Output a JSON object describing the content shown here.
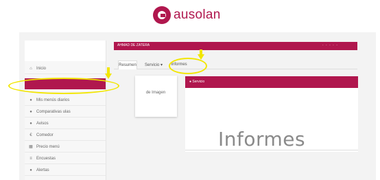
{
  "logo": {
    "text": "ausolan"
  },
  "header": {
    "title": "AHMAD DE ZATERA",
    "right": "· · · · ·"
  },
  "sidebar": {
    "items": [
      {
        "icon": "home-icon",
        "glyph": "⌂",
        "label": "Inicio"
      },
      {
        "icon": "",
        "glyph": "",
        "label": ""
      },
      {
        "icon": "circle-icon",
        "glyph": "●",
        "label": "Mis menús diarios"
      },
      {
        "icon": "circle-icon",
        "glyph": "●",
        "label": "Comparativas ulas"
      },
      {
        "icon": "circle-icon",
        "glyph": "●",
        "label": "Avisos"
      },
      {
        "icon": "euro-icon",
        "glyph": "€",
        "label": "Comedor"
      },
      {
        "icon": "document-icon",
        "glyph": "▦",
        "label": "Precio menú"
      },
      {
        "icon": "list-icon",
        "glyph": "≡",
        "label": "Encuestas"
      },
      {
        "icon": "circle-icon",
        "glyph": "●",
        "label": "Alertas"
      }
    ]
  },
  "tabs": [
    {
      "label": "Resumen"
    },
    {
      "label": "Servicio ▾"
    },
    {
      "label": "Informes"
    }
  ],
  "card": {
    "label": "de Imagen"
  },
  "panel": {
    "title": "● Servicio",
    "big_text": "Informes"
  },
  "colors": {
    "brand": "#b0174e",
    "annotation": "#f2e600"
  }
}
